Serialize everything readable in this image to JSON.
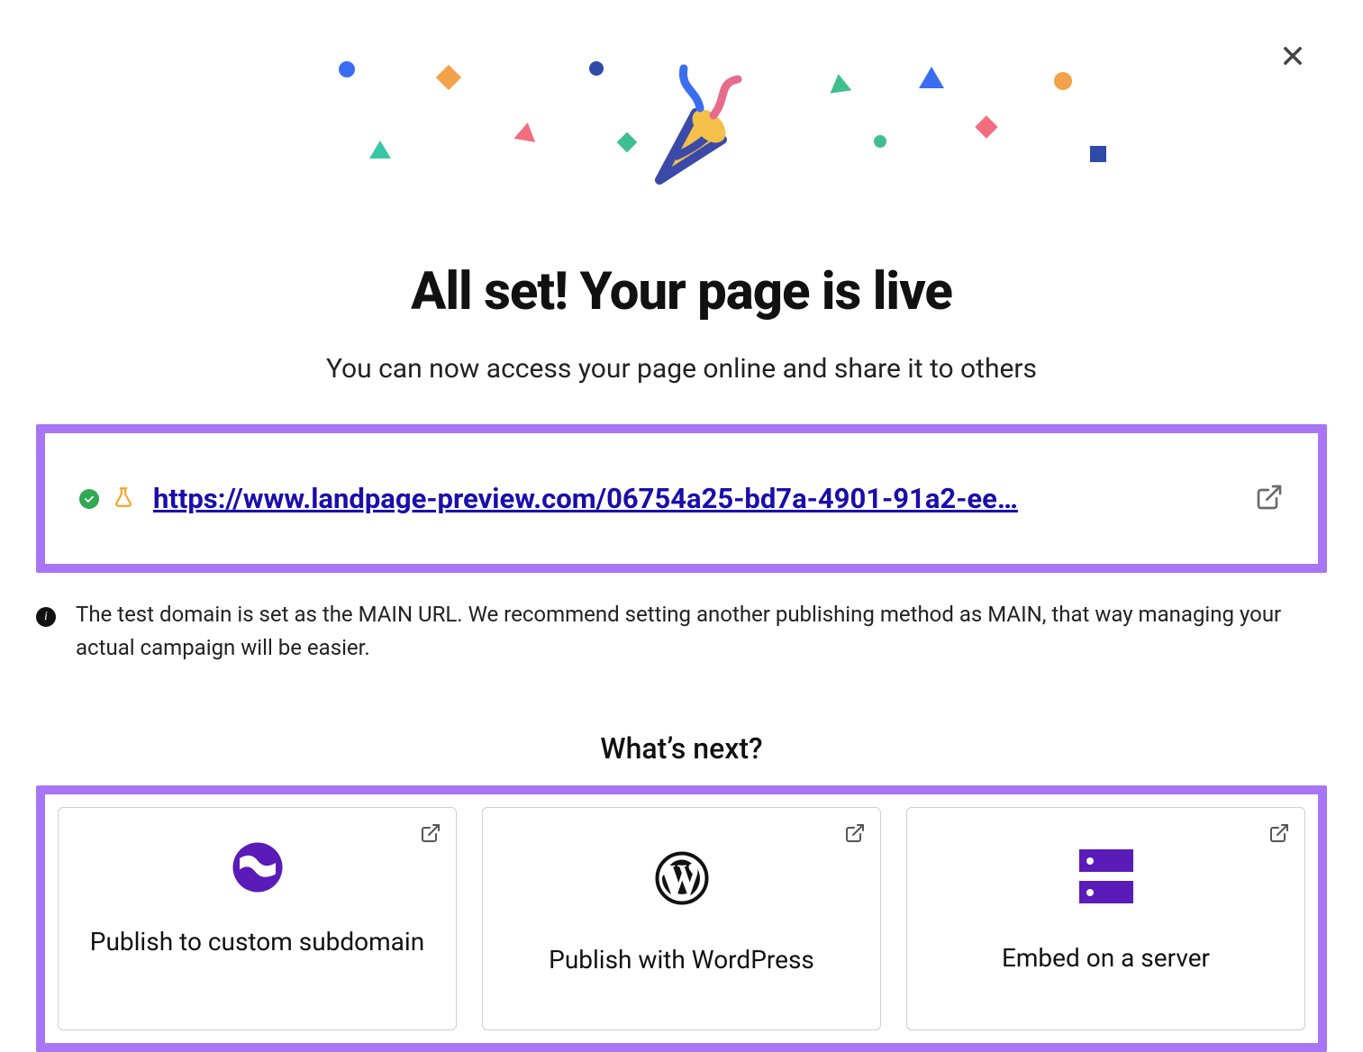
{
  "modal": {
    "headline": "All set! Your page is live",
    "subhead": "You can now access your page online and share it to others"
  },
  "url_box": {
    "url": "https://www.landpage-preview.com/06754a25-bd7a-4901-91a2-ee…"
  },
  "info": {
    "text": "The test domain is set as the MAIN URL. We recommend setting another publishing method as MAIN, that way managing your actual campaign will be easier."
  },
  "next": {
    "heading": "What’s next?",
    "cards": [
      {
        "title": "Publish to custom subdomain"
      },
      {
        "title": "Publish with WordPress"
      },
      {
        "title": "Embed on a server"
      }
    ]
  },
  "colors": {
    "accent": "#a876f5",
    "link": "#1a0dab",
    "success": "#32a852",
    "flask": "#f5a623",
    "globe": "#5a1bb8"
  }
}
